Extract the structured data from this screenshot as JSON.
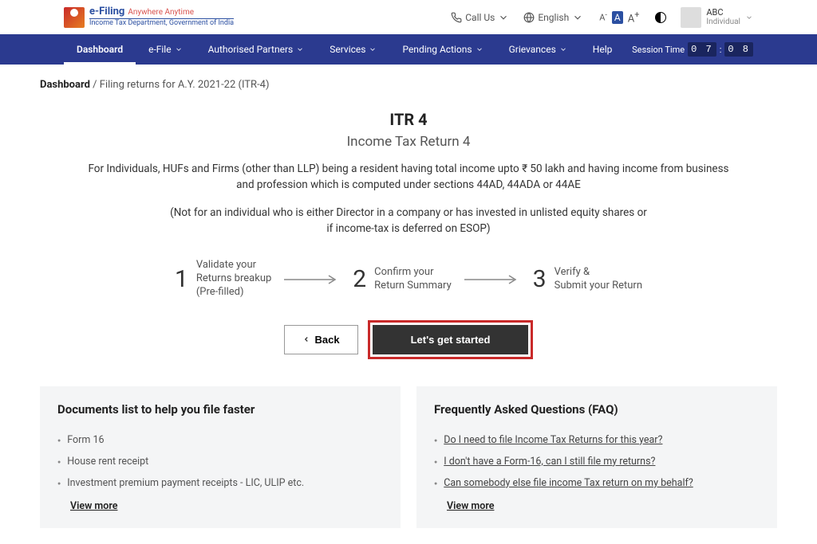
{
  "header": {
    "logo_title": "e-Filing",
    "logo_tag": "Anywhere Anytime",
    "logo_sub": "Income Tax Department, Government of India",
    "call_us": "Call Us",
    "language": "English",
    "user_name": "ABC",
    "user_type": "Individual"
  },
  "nav": {
    "items": [
      "Dashboard",
      "e-File",
      "Authorised Partners",
      "Services",
      "Pending Actions",
      "Grievances",
      "Help"
    ],
    "session_label": "Session Time",
    "session_mm": "0 7",
    "session_ss": "0 8"
  },
  "breadcrumb": {
    "root": "Dashboard",
    "current": "Filing returns for A.Y. 2021-22 (ITR-4)"
  },
  "main": {
    "title": "ITR 4",
    "subtitle": "Income Tax Return 4",
    "desc1": "For Individuals, HUFs and Firms (other than LLP) being a resident having total income upto ₹ 50 lakh and having income from business and profession which is computed under sections 44AD, 44ADA or 44AE",
    "desc2a": "(Not for an individual who is either Director in a company or has invested in unlisted equity shares or",
    "desc2b": "if income-tax is deferred on ESOP)"
  },
  "steps": [
    {
      "num": "1",
      "line1": "Validate your",
      "line2": "Returns breakup",
      "line3": "(Pre-filled)"
    },
    {
      "num": "2",
      "line1": "Confirm your",
      "line2": "Return Summary",
      "line3": ""
    },
    {
      "num": "3",
      "line1": "Verify &",
      "line2": "Submit your Return",
      "line3": ""
    }
  ],
  "buttons": {
    "back": "Back",
    "primary": "Let's get started"
  },
  "panels": {
    "docs": {
      "title": "Documents list to help you file faster",
      "items": [
        "Form 16",
        "House rent receipt",
        "Investment premium payment receipts - LIC, ULIP etc."
      ],
      "viewmore": "View more"
    },
    "faq": {
      "title": "Frequently Asked Questions (FAQ)",
      "items": [
        "Do I need to file Income Tax Returns for this year?",
        "I don't have a Form-16, can I still file my returns?",
        "Can somebody else file income Tax return on my behalf?"
      ],
      "viewmore": "View more"
    }
  }
}
